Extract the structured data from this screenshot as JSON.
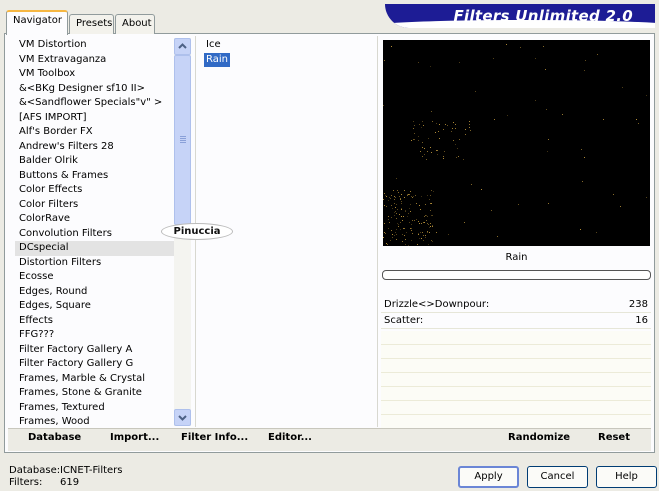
{
  "window": {
    "title": "Filters Unlimited 2.0"
  },
  "tabs": [
    {
      "label": "Navigator",
      "active": true
    },
    {
      "label": "Presets",
      "active": false
    },
    {
      "label": "About",
      "active": false
    }
  ],
  "categories": [
    "VM Distortion",
    "VM Extravaganza",
    "VM Toolbox",
    "&<BKg Designer sf10 II>",
    "&<Sandflower Specials\"v\" >",
    "[AFS IMPORT]",
    "Alf's Border FX",
    "Andrew's Filters 28",
    "Balder Olrik",
    "Buttons & Frames",
    "Color Effects",
    "Color Filters",
    "ColorRave",
    "Convolution Filters",
    "DCspecial",
    "Distortion Filters",
    "Ecosse",
    "Edges, Round",
    "Edges, Square",
    "Effects",
    "FFG???",
    "Filter Factory Gallery A",
    "Filter Factory Gallery G",
    "Frames, Marble & Crystal",
    "Frames, Stone & Granite",
    "Frames, Textured",
    "Frames, Wood"
  ],
  "selected_category_index": 14,
  "filters": [
    {
      "label": "Ice",
      "selected": false
    },
    {
      "label": "Rain",
      "selected": true
    }
  ],
  "watermark": "Pinuccia",
  "preview": {
    "filter_name": "Rain"
  },
  "params": [
    {
      "label": "Drizzle<>Downpour:",
      "value": "238"
    },
    {
      "label": "Scatter:",
      "value": "16"
    }
  ],
  "toolbar": {
    "database": "Database",
    "import": "Import...",
    "filter_info": "Filter Info...",
    "editor": "Editor...",
    "randomize": "Randomize",
    "reset": "Reset"
  },
  "status": {
    "database_label": "Database:",
    "database_value": "ICNET-Filters",
    "filters_label": "Filters:",
    "filters_value": "619"
  },
  "buttons": {
    "apply": "Apply",
    "cancel": "Cancel",
    "help": "Help"
  },
  "colors": {
    "banner": "#1d1c95",
    "selection": "#316ac5",
    "tab_highlight": "#f6b742",
    "scrollbar": "#c6d3f7"
  }
}
